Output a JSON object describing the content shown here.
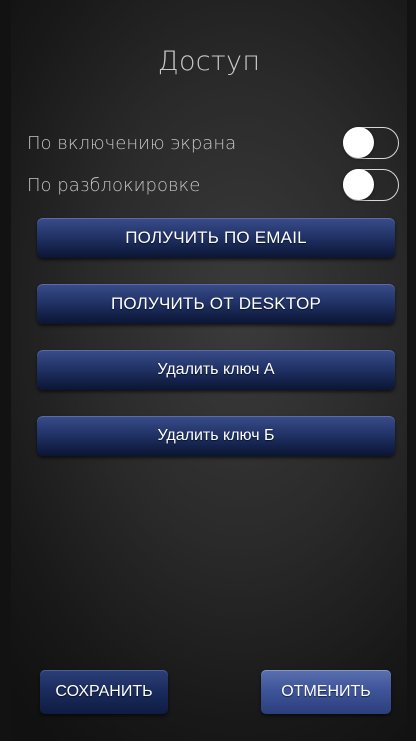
{
  "header": {
    "title": "Доступ"
  },
  "options": [
    {
      "label": "По включению экрана",
      "toggle_on": false
    },
    {
      "label": "По разблокировке",
      "toggle_on": false
    }
  ],
  "actions": {
    "get_by_email": "ПОЛУЧИТЬ ПО EMAIL",
    "get_from_desktop": "ПОЛУЧИТЬ ОТ DESKTOP",
    "delete_key_a": "Удалить ключ А",
    "delete_key_b": "Удалить ключ Б"
  },
  "footer": {
    "save_label": "СОХРАНИТЬ",
    "cancel_label": "ОТМЕНИТЬ"
  },
  "colors": {
    "button_blue": "#1b2c5e",
    "button_blue_light": "#3f559a",
    "background": "#2a2a2a",
    "text": "#c4c4c4"
  }
}
